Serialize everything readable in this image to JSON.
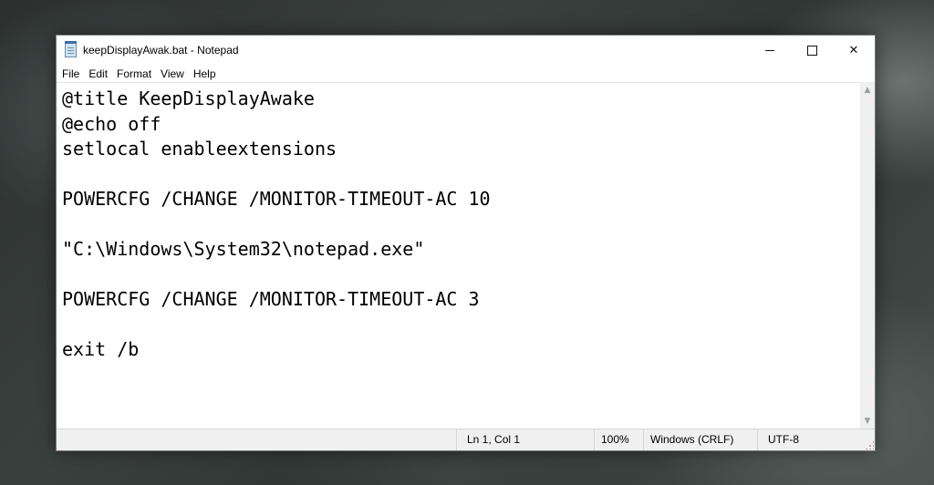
{
  "window": {
    "title": "keepDisplayAwak.bat - Notepad",
    "icon": "notepad-icon",
    "controls": {
      "minimize": "minimize-icon",
      "maximize": "maximize-icon",
      "close": "close-icon",
      "close_glyph": "✕"
    }
  },
  "menu": {
    "items": [
      {
        "label": "File"
      },
      {
        "label": "Edit"
      },
      {
        "label": "Format"
      },
      {
        "label": "View"
      },
      {
        "label": "Help"
      }
    ]
  },
  "editor": {
    "lines": [
      "@title KeepDisplayAwake",
      "@echo off",
      "setlocal enableextensions",
      "",
      "POWERCFG /CHANGE /MONITOR-TIMEOUT-AC 10",
      "",
      "\"C:\\Windows\\System32\\notepad.exe\"",
      "",
      "POWERCFG /CHANGE /MONITOR-TIMEOUT-AC 3",
      "",
      "exit /b"
    ]
  },
  "scrollbar": {
    "up_glyph": "▲",
    "down_glyph": "▼"
  },
  "status": {
    "position": "Ln 1, Col 1",
    "zoom": "100%",
    "line_endings": "Windows (CRLF)",
    "encoding": "UTF-8"
  }
}
